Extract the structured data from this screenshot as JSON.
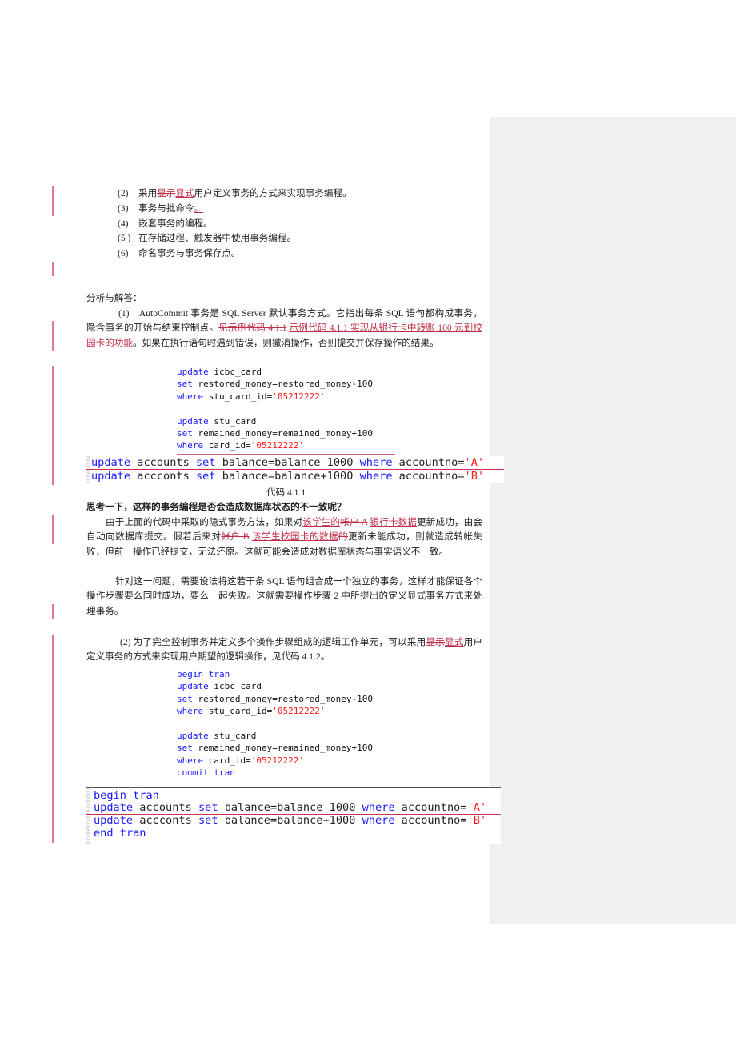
{
  "list": [
    {
      "num": "(2)",
      "segs": [
        "采用",
        "显示",
        "显式",
        "用户定义事务的方式来实现事务编程。"
      ]
    },
    {
      "num": "(3)",
      "segs": [
        "事务与批命令",
        "。"
      ]
    },
    {
      "num": "(4)",
      "text": "嵌套事务的编程。"
    },
    {
      "num": "(5 )",
      "text": "在存储过程、触发器中使用事务编程。"
    },
    {
      "num": "(6)",
      "text": "命名事务与事务保存点。"
    }
  ],
  "analysis_heading": "分析与解答：",
  "para1": {
    "segs": [
      "(1)　AutoCommit 事务是 SQL Server 默认事务方式。它指出每条 SQL 语句都构成事务，隐含事务的开始与结束控制点。",
      "见示例代码 4.1.1",
      "示例代码 4.1.1 实现从银行卡中转账 100 元到校园卡的功能",
      "。如果在执行语句时遇到错误，则撤消操作，否则提交并保存操作的结果。"
    ]
  },
  "code1": [
    {
      "kw": "update",
      "rest": " icbc_card"
    },
    {
      "kw": "set",
      "rest": " restored_money=restored_money-100"
    },
    {
      "kw": "where",
      "rest": " stu_card_id=",
      "str": "'05212222'"
    },
    {
      "kw": "update",
      "rest": " stu_card"
    },
    {
      "kw": "set",
      "rest": " remained_money=remained_money+100"
    },
    {
      "kw": "where",
      "rest": " card_id=",
      "str": "'05212222'"
    }
  ],
  "shot1": [
    {
      "k1": "update",
      "t1": " accounts ",
      "k2": "set",
      "t2": " balance=balance-1000 ",
      "k3": "where",
      "t3": " accountno=",
      "s": "'A'"
    },
    {
      "k1": "update",
      "t1": " accconts ",
      "k2": "set",
      "t2": " balance=balance+1000 ",
      "k3": "where",
      "t3": " accountno=",
      "s": "'B'"
    }
  ],
  "caption1": "代码 4.1.1",
  "question": "思考一下，这样的事务编程是否会造成数据库状态的不一致呢？",
  "para2": {
    "segs": [
      "由于上面的代码中采取的隐式事务方法，如果对",
      "该学生的",
      "帐户 A",
      "银行卡数据",
      "更新成功，由会自动向数据库提交。假若后来对",
      "帐户 B",
      "该学生校园卡的数据",
      "的",
      "更新未能成功，则就造成转帐失败，但前一操作已经提交，无法还原。这就可能会造成对数据库状态与事实语义不一致。"
    ]
  },
  "para3": "针对这一问题，需要设法将这若干条 SQL 语句组合成一个独立的事务，这样才能保证各个操作步骤要么同时成功，要么一起失败。这就需要操作步骤 2 中所提出的定义显式事务方式来处理事务。",
  "para4": {
    "segs": [
      "(2)  为了完全控制事务并定义多个操作步骤组成的逻辑工作单元，可以采用",
      "显示",
      "显式",
      "用户定义事务的方式来实现用户期望的逻辑操作，见代码 4.1.2。"
    ]
  },
  "code2": [
    {
      "kw": "begin tran",
      "rest": ""
    },
    {
      "kw": "update",
      "rest": " icbc_card"
    },
    {
      "kw": "set",
      "rest": " restored_money=restored_money-100"
    },
    {
      "kw": "where",
      "rest": " stu_card_id=",
      "str": "'05212222'"
    },
    {
      "kw": "update",
      "rest": " stu_card"
    },
    {
      "kw": "set",
      "rest": " remained_money=remained_money+100"
    },
    {
      "kw": "where",
      "rest": " card_id=",
      "str": "'05212222'"
    },
    {
      "kw": "commit tran",
      "rest": ""
    }
  ],
  "shot2": {
    "begin": "begin tran",
    "lines": [
      {
        "k1": "update",
        "t1": " accounts ",
        "k2": "set",
        "t2": " balance=balance-1000 ",
        "k3": "where",
        "t3": " accountno=",
        "s": "'A'"
      },
      {
        "k1": "update",
        "t1": " accconts ",
        "k2": "set",
        "t2": " balance=balance+1000 ",
        "k3": "where",
        "t3": " accountno=",
        "s": "'B'"
      }
    ],
    "end": "end tran"
  },
  "colors": {
    "revision": "#c0304a",
    "keyword": "#1a1aff",
    "string": "#ff1a1a",
    "comment_pane": "#f0f0f0"
  }
}
